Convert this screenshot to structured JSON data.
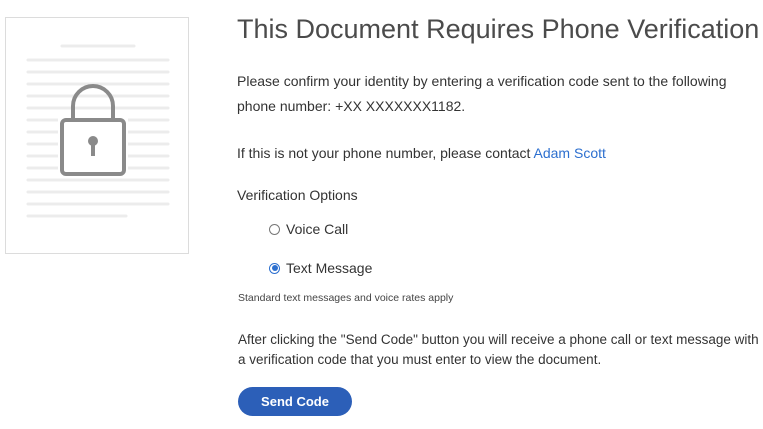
{
  "page": {
    "title": "This Document Requires Phone Verification",
    "intro": "Please confirm your identity by entering a verification code sent to the following phone number: +XX XXXXXXX1182.",
    "contact_prefix": "If this is not your phone number, please contact ",
    "contact_name": "Adam Scott",
    "options_heading": "Verification Options",
    "options": [
      {
        "label": "Voice Call",
        "selected": false
      },
      {
        "label": "Text Message",
        "selected": true
      }
    ],
    "rates_note": "Standard text messages and voice rates apply",
    "after_text": "After clicking the \"Send Code\" button you will receive a phone call or text message with a verification code that you must enter to view the document.",
    "send_label": "Send Code"
  },
  "icons": {
    "document": "locked-document-icon",
    "lock": "padlock-icon"
  },
  "colors": {
    "accent": "#2c5fb8",
    "link": "#2c6fcf",
    "lock_gray": "#8a8a8a",
    "doc_lines": "#ececec"
  }
}
